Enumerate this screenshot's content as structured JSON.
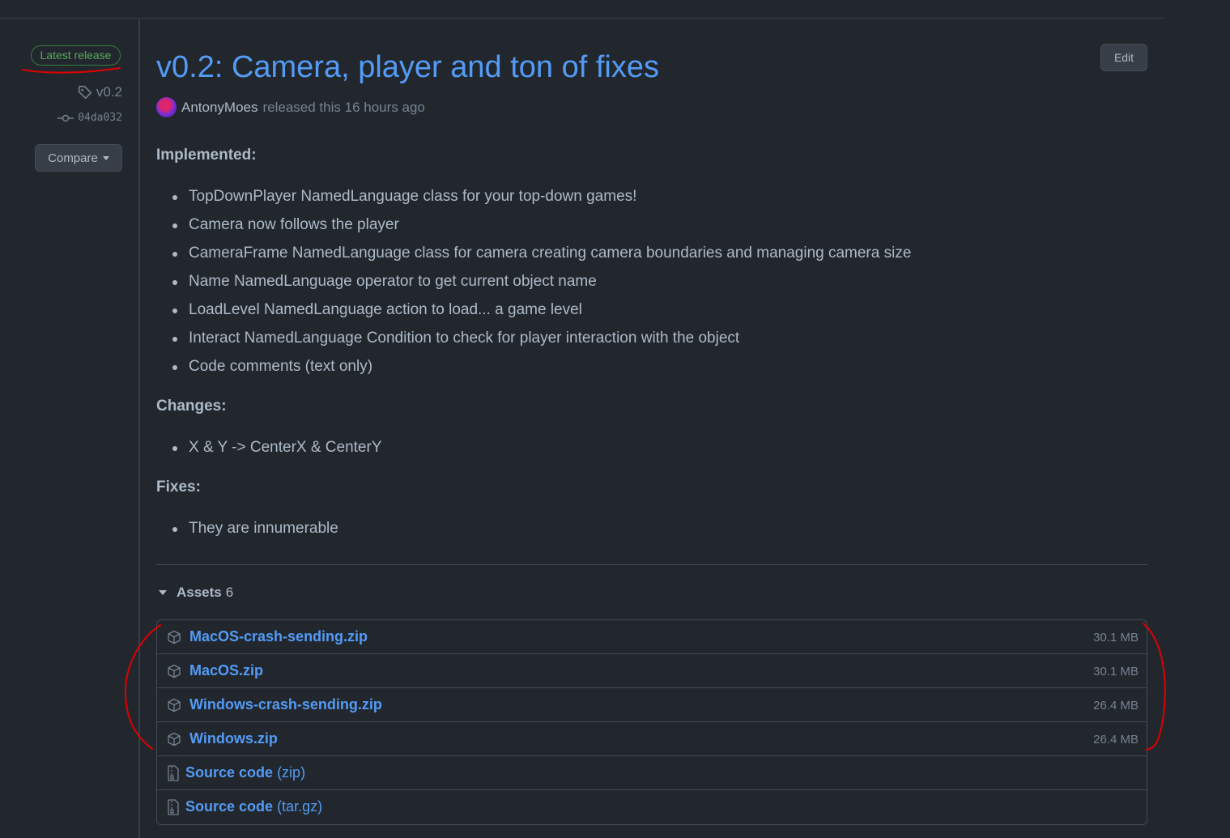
{
  "meta": {
    "badge": "Latest release",
    "tag": "v0.2",
    "commit": "04da032",
    "compare_label": "Compare"
  },
  "release": {
    "title": "v0.2: Camera, player and ton of fixes",
    "edit_label": "Edit",
    "author": "AntonyMoes",
    "released_text": "released this 16 hours ago"
  },
  "notes": {
    "implemented_heading": "Implemented:",
    "implemented": [
      "TopDownPlayer NamedLanguage class for your top-down games!",
      "Camera now follows the player",
      "CameraFrame NamedLanguage class for camera creating camera boundaries and managing camera size",
      "Name NamedLanguage operator to get current object name",
      "LoadLevel NamedLanguage action to load... a game level",
      "Interact NamedLanguage Condition to check for player interaction with the object",
      "Code comments (text only)"
    ],
    "changes_heading": "Changes:",
    "changes": [
      "X & Y -> CenterX & CenterY"
    ],
    "fixes_heading": "Fixes:",
    "fixes": [
      "They are innumerable"
    ]
  },
  "assets": {
    "label": "Assets",
    "count": "6",
    "files": [
      {
        "name": "MacOS-crash-sending.zip",
        "size": "30.1 MB"
      },
      {
        "name": "MacOS.zip",
        "size": "30.1 MB"
      },
      {
        "name": "Windows-crash-sending.zip",
        "size": "26.4 MB"
      },
      {
        "name": "Windows.zip",
        "size": "26.4 MB"
      }
    ],
    "source": [
      {
        "label": "Source code",
        "format": "(zip)"
      },
      {
        "label": "Source code",
        "format": "(tar.gz)"
      }
    ]
  },
  "colors": {
    "background": "#22272e",
    "link": "#539bf5",
    "badge_green": "#57ab5a",
    "annotation_red": "#e00000"
  },
  "icons": [
    "tag-icon",
    "commit-icon",
    "package-icon",
    "file-zip-icon",
    "triangle-down-icon"
  ]
}
